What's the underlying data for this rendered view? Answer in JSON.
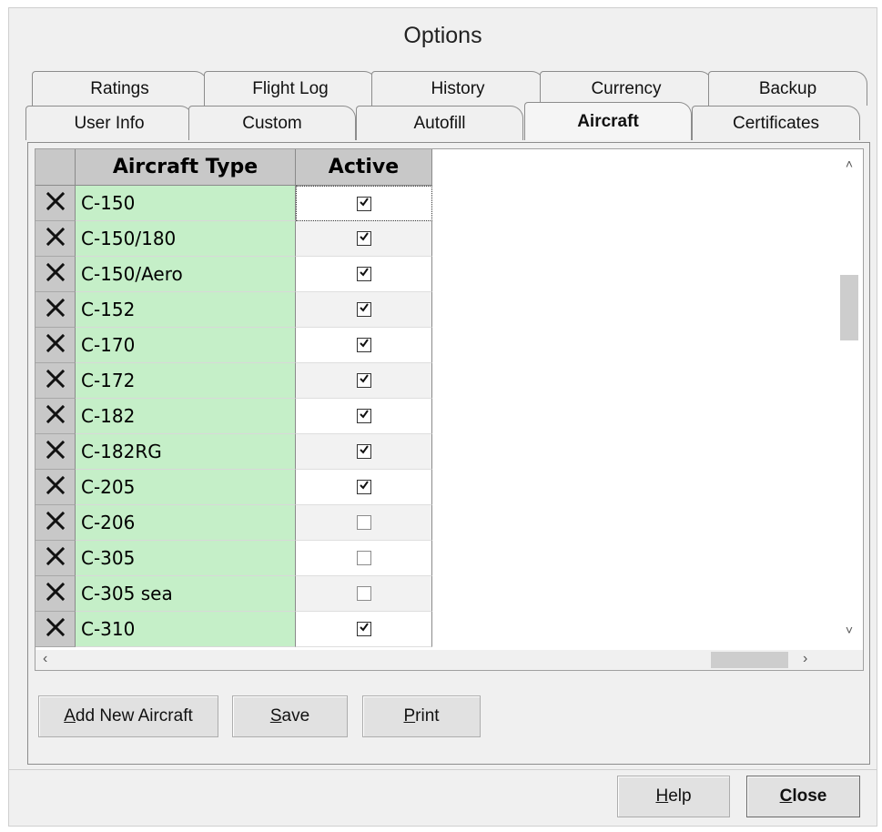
{
  "window": {
    "title": "Options"
  },
  "tabs_back": [
    "Ratings",
    "Flight Log",
    "History",
    "Currency",
    "Backup"
  ],
  "tabs_front": [
    "User Info",
    "Custom",
    "Autofill",
    "Aircraft",
    "Certificates"
  ],
  "active_tab": "Aircraft",
  "grid": {
    "columns": [
      "Aircraft Type",
      "Active"
    ],
    "rows": [
      {
        "type": "C-150",
        "active": true
      },
      {
        "type": "C-150/180",
        "active": true
      },
      {
        "type": "C-150/Aero",
        "active": true
      },
      {
        "type": "C-152",
        "active": true
      },
      {
        "type": "C-170",
        "active": true
      },
      {
        "type": "C-172",
        "active": true
      },
      {
        "type": "C-182",
        "active": true
      },
      {
        "type": "C-182RG",
        "active": true
      },
      {
        "type": "C-205",
        "active": true
      },
      {
        "type": "C-206",
        "active": false
      },
      {
        "type": "C-305",
        "active": false
      },
      {
        "type": "C-305 sea",
        "active": false
      },
      {
        "type": "C-310",
        "active": true
      }
    ],
    "delete_icon": "x-delete-icon",
    "checkmark_icon": "checkmark-icon"
  },
  "buttons": {
    "add_prefix": "A",
    "add_rest": "dd New Aircraft",
    "save_prefix": "S",
    "save_rest": "ave",
    "print_prefix": "P",
    "print_rest": "rint",
    "help_prefix": "H",
    "help_rest": "elp",
    "close_prefix": "C",
    "close_rest": "lose"
  },
  "colors": {
    "type_cell_bg": "#c5efc8",
    "header_bg": "#c8c8c8"
  }
}
